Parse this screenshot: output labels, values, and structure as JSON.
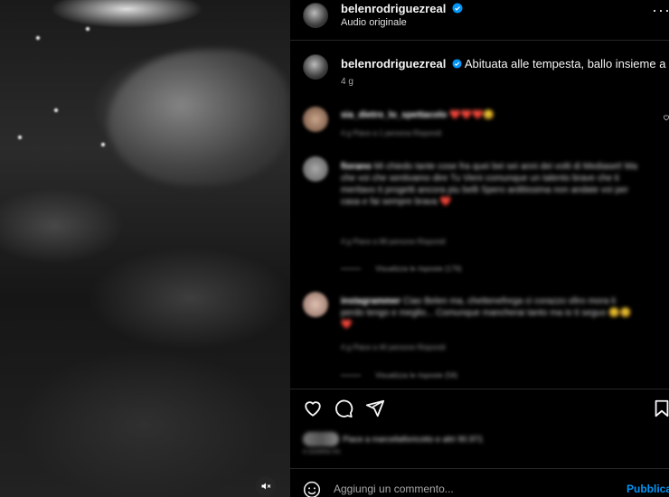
{
  "post": {
    "username": "belenrodriguezreal",
    "audio": "Audio originale",
    "caption": "Abituata alle tempesta, ballo insieme a lei",
    "time": "4 g"
  },
  "comments": [
    {
      "username": "sia_dietro_lo_spettacolo",
      "text": "❤️❤️❤️😊",
      "meta": "4 g   Piace a 1 persona   Rispondi"
    },
    {
      "username": "fiorano",
      "text": "Mi chiedo tante cose fra quei bei sei anni dei volti di Mediaset! Ma che voi che sentivamo dire Tu Vieni comunque un talento brave che ti meritavo ti progetti ancora piu belli Spero arditissima non andate voi per casa e fai sempre brava ❤️",
      "meta": "4 g   Piace a 98 persone   Rispondi",
      "replies": "Visualizza le risposte (176)"
    },
    {
      "username": "instagrammer",
      "text": "Ciao Belen ma, chettenefrega ci corazzo sfiro mora ti perdo tengo e meglio... Comunque mancherai tanto ma io ti seguo 😊😊❤️",
      "meta": "4 g   Piace a 40 persone   Rispondi",
      "replies": "Visualizza le risposte (58)"
    }
  ],
  "likes_text": "Piace a marcellafioricotto e altri 90.971",
  "likes_time": "4 GIORNI FA",
  "add_comment_placeholder": "Aggiungi un commento...",
  "publish_label": "Pubblica",
  "colors": {
    "accent": "#0095f6",
    "verified": "#0095f6",
    "bg": "#000000",
    "divider": "#262626"
  },
  "icons": [
    "heart-icon",
    "comment-icon",
    "share-icon",
    "bookmark-icon",
    "emoji-icon",
    "mute-icon",
    "more-icon",
    "verified-icon"
  ]
}
